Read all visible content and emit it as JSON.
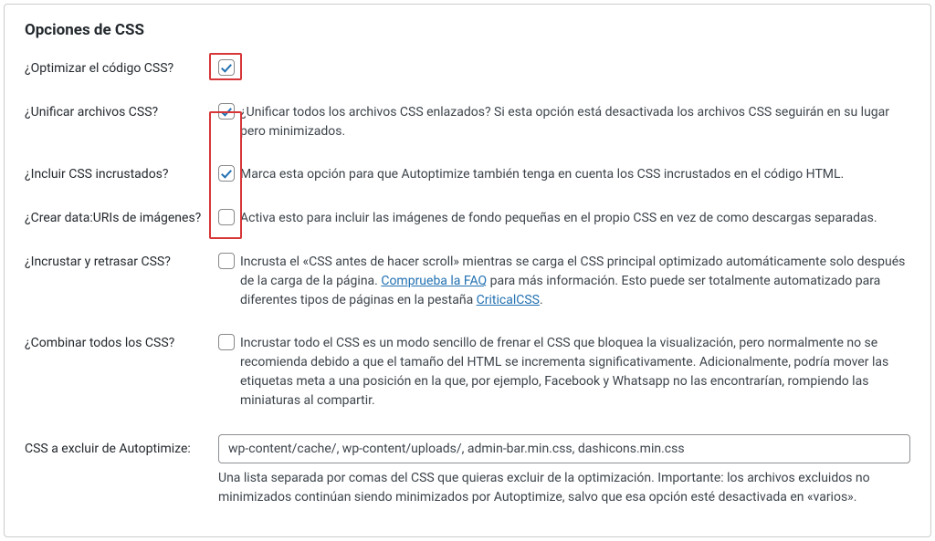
{
  "panel": {
    "title": "Opciones de CSS"
  },
  "options": {
    "optimize": {
      "label": "¿Optimizar el código CSS?",
      "checked": true,
      "desc": ""
    },
    "aggregate": {
      "label": "¿Unificar archivos CSS?",
      "checked": true,
      "desc": "¿Unificar todos los archivos CSS enlazados? Si esta opción está desactivada los archivos CSS seguirán en su lugar pero minimizados."
    },
    "inline": {
      "label": "¿Incluir CSS incrustados?",
      "checked": true,
      "desc": "Marca esta opción para que Autoptimize también tenga en cuenta los CSS incrustados en el código HTML."
    },
    "datauri": {
      "label": "¿Crear data:URIs de imágenes?",
      "checked": false,
      "desc": "Activa esto para incluir las imágenes de fondo pequeñas en el propio CSS en vez de como descargas separadas."
    },
    "defer": {
      "label": "¿Incrustar y retrasar CSS?",
      "checked": false,
      "desc_pre": "Incrusta el «CSS antes de hacer scroll» mientras se carga el CSS principal optimizado automáticamente solo después de la carga de la página. ",
      "link1": "Comprueba la FAQ",
      "desc_mid": " para más información. Esto puede ser totalmente automatizado para diferentes tipos de páginas en la pestaña ",
      "link2": "CriticalCSS",
      "desc_post": "."
    },
    "inlineall": {
      "label": "¿Combinar todos los CSS?",
      "checked": false,
      "desc": "Incrustar todo el CSS es un modo sencillo de frenar el CSS que bloquea la visualización, pero normalmente no se recomienda debido a que el tamaño del HTML se incrementa significativamente. Adicionalmente, podría mover las etiquetas meta a una posición en la que, por ejemplo, Facebook y Whatsapp no las encontrarían, rompiendo las miniaturas al compartir."
    },
    "exclude": {
      "label": "CSS a excluir de Autoptimize:",
      "value": "wp-content/cache/, wp-content/uploads/, admin-bar.min.css, dashicons.min.css",
      "help": "Una lista separada por comas del CSS que quieras excluir de la optimización. Importante: los archivos excluidos no minimizados continúan siendo minimizados por Autoptimize, salvo que esa opción esté desactivada en «varios»."
    }
  }
}
